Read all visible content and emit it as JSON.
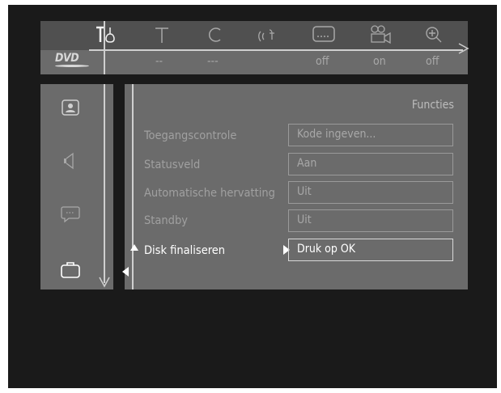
{
  "top_bar": {
    "icons": [
      "tools-icon",
      "title-icon",
      "chapter-icon",
      "audio-icon",
      "subtitle-icon",
      "angle-icon",
      "zoom-icon"
    ],
    "disc_logo": "DVD",
    "values": [
      "--",
      "---",
      "off",
      "on",
      "off"
    ]
  },
  "side_menu": {
    "items": [
      "picture-icon",
      "sound-icon",
      "language-icon",
      "features-icon"
    ],
    "selected": "features-icon"
  },
  "main": {
    "title": "Functies",
    "rows": [
      {
        "label": "Toegangscontrole",
        "value": "Kode ingeven..."
      },
      {
        "label": "Statusveld",
        "value": "Aan"
      },
      {
        "label": "Automatische hervatting",
        "value": "Uit"
      },
      {
        "label": "Standby",
        "value": "Uit"
      },
      {
        "label": "Disk finaliseren",
        "value": "Druk op OK"
      }
    ],
    "selected_row": 4
  },
  "colors": {
    "screen_bg": "#1a1a1a",
    "panel_bg": "#6b6b6b",
    "icon_bar_bg": "#505050",
    "text_dim": "#a0a0a0",
    "text_active": "#ffffff"
  }
}
